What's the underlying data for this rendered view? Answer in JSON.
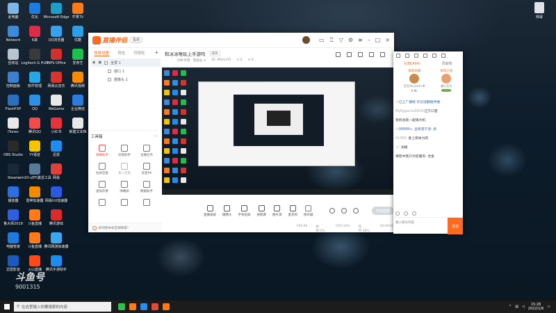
{
  "desktop": {
    "icons": [
      {
        "label": "此电脑",
        "color": "#7fb6e8"
      },
      {
        "label": "优化",
        "color": "#1e7be0"
      },
      {
        "label": "Microsoft Edge",
        "color": "#1aa0c8"
      },
      {
        "label": "芒果TV",
        "color": "#ff7a1a"
      },
      {
        "label": "Network",
        "color": "#3d8bd8"
      },
      {
        "label": "K歌",
        "color": "#e02a4a"
      },
      {
        "label": "QQ浏览器",
        "color": "#35a3f0"
      },
      {
        "label": "优酷",
        "color": "#29a0e8"
      },
      {
        "label": "回收站",
        "color": "#b8c4d0"
      },
      {
        "label": "Logitech G HUB",
        "color": "#3a3a3a"
      },
      {
        "label": "WPS Office",
        "color": "#d0312d"
      },
      {
        "label": "爱奇艺",
        "color": "#1cc04a"
      },
      {
        "label": "控制面板",
        "color": "#3c7fd0"
      },
      {
        "label": "软件管理",
        "color": "#25a9e6"
      },
      {
        "label": "网易云音乐",
        "color": "#d7342b"
      },
      {
        "label": "腾讯视频",
        "color": "#ff8a00"
      },
      {
        "label": "FlashFXP",
        "color": "#2a70c0"
      },
      {
        "label": "QQ",
        "color": "#2f8fe0"
      },
      {
        "label": "WeGame",
        "color": "#e8e8e8"
      },
      {
        "label": "企业微信",
        "color": "#2c7ce0"
      },
      {
        "label": "iTunes",
        "color": "#e8e8e8"
      },
      {
        "label": "腾讯QQ",
        "color": "#ef4d4d"
      },
      {
        "label": "小红书",
        "color": "#e8333c"
      },
      {
        "label": "新建文本档",
        "color": "#e8e8e8"
      },
      {
        "label": "OBS Studio",
        "color": "#2a2a2a"
      },
      {
        "label": "YY语音",
        "color": "#f5c400"
      },
      {
        "label": "迅雷",
        "color": "#1d8ef0"
      },
      {
        "label": "",
        "color": "#000000"
      },
      {
        "label": "Steam",
        "color": "#1b2838"
      },
      {
        "label": "win10-uEFI激活工具",
        "color": "#5a7a9a"
      },
      {
        "label": "网易",
        "color": "#e0403a"
      },
      {
        "label": "",
        "color": "#000000"
      },
      {
        "label": "播放器",
        "color": "#2e6fe0"
      },
      {
        "label": "雷神加速器",
        "color": "#f08c00"
      },
      {
        "label": "网易UU加速器",
        "color": "#2a5ae0"
      },
      {
        "label": "",
        "color": "#000000"
      },
      {
        "label": "鲁大师2019",
        "color": "#2f5fe0"
      },
      {
        "label": "斗鱼直播",
        "color": "#ff7a1a"
      },
      {
        "label": "腾讯游戏",
        "color": "#dd2a2a"
      },
      {
        "label": "",
        "color": "#000000"
      },
      {
        "label": "电脑管家",
        "color": "#1e7ae0"
      },
      {
        "label": "斗鱼直播",
        "color": "#ff7a1a"
      },
      {
        "label": "腾讯网游加速器",
        "color": "#3aa8f0"
      },
      {
        "label": "",
        "color": "#000000"
      },
      {
        "label": "迅雷影音",
        "color": "#1a5ac0"
      },
      {
        "label": "火山直播",
        "color": "#ff4a1a"
      },
      {
        "label": "腾讯手游助手",
        "color": "#1d8ef0"
      }
    ],
    "topright_icon_label": "帅哥"
  },
  "app": {
    "brand": "直播伴侣",
    "version_tag": "极简",
    "tabs": [
      {
        "label": "场景设置",
        "active": true
      },
      {
        "label": "背包",
        "active": false
      },
      {
        "label": "可视化",
        "active": false
      }
    ],
    "add_symbol": "+",
    "scenes": [
      "全屏 1",
      "窗口 1",
      "摄像头 1"
    ],
    "toolbox_title": "工具箱",
    "toolbox_more": "…",
    "tools": [
      {
        "label": "弹幕助手",
        "style": "red"
      },
      {
        "label": "房管助手",
        "style": "normal"
      },
      {
        "label": "主播任务",
        "style": "normal"
      },
      {
        "label": "投屏连麦",
        "style": "normal"
      },
      {
        "label": "素人连麦",
        "style": "gray"
      },
      {
        "label": "连麦PK",
        "style": "normal"
      },
      {
        "label": "虚拟形象",
        "style": "normal"
      },
      {
        "label": "弹幕屏",
        "style": "normal"
      },
      {
        "label": "数据助手",
        "style": "normal"
      },
      {
        "label": "",
        "style": "normal"
      },
      {
        "label": "",
        "style": "normal"
      },
      {
        "label": "",
        "style": "normal"
      }
    ],
    "notice": "如何把本机音频降噪？",
    "stream_title": "和冰冰唯玩上手游吗",
    "stream_tag": "编辑",
    "stream_meta": [
      "DNF手游 · 电视主 ∠",
      "ID: 9001315",
      "⊙ 0",
      "⊙ 0"
    ],
    "controls": [
      {
        "label": "直播录屏",
        "style": "normal"
      },
      {
        "label": "摄像头",
        "style": "normal"
      },
      {
        "label": "手机投屏",
        "style": "normal"
      },
      {
        "label": "视频源",
        "style": "normal"
      },
      {
        "label": "图片源",
        "style": "normal"
      },
      {
        "label": "麦克风",
        "style": "normal"
      },
      {
        "label": "扬声器",
        "style": "red"
      }
    ],
    "go_live_label": "开始直播",
    "status": [
      "FPS:60",
      "帧率:0%",
      "CPU:10%",
      "内存:58%",
      "00:00:00"
    ]
  },
  "chat": {
    "tabs": [
      {
        "label": "礼物(494)",
        "active": true
      },
      {
        "label": "贡献榜",
        "active": false
      }
    ],
    "gifts": [
      {
        "title": "本周贡献",
        "name": "豆豆冰儿Lam•幸",
        "badge": "8.8k"
      },
      {
        "title": "本周之星",
        "name": "越公豆贝",
        "badge": ""
      }
    ],
    "messages": [
      {
        "user": "小",
        "text": "已上广播榜  东北话翻唱伴播",
        "type": "gift"
      },
      {
        "user": "MyEggache0818:",
        "text": "辽宁口音",
        "type": "chat"
      },
      {
        "user": "",
        "text": "有机会就一起嗨大机",
        "type": "chat"
      },
      {
        "user": "小",
        "text": "99999+, 全民谱干货: 武",
        "type": "gift"
      },
      {
        "user": "01369: ",
        "text": "身上有体力的",
        "type": "chat"
      },
      {
        "user": "小: ",
        "text": "加格",
        "type": "chat"
      },
      {
        "user": "",
        "text": "保密中我只为您服务:  合金",
        "type": "chat"
      }
    ],
    "input_placeholder": "输入聊天内容",
    "send_label": "发送"
  },
  "watermark": {
    "brand": "斗鱼号",
    "id": "9001315"
  },
  "taskbar": {
    "search_placeholder": "在这里输入你要搜索的内容",
    "app_colors": [
      "#2fbf4a",
      "#ff7a1a",
      "#2a8ef0",
      "#e24a3a",
      "#ff7a1a"
    ],
    "time": "15:28",
    "date": "2022/1/6"
  }
}
